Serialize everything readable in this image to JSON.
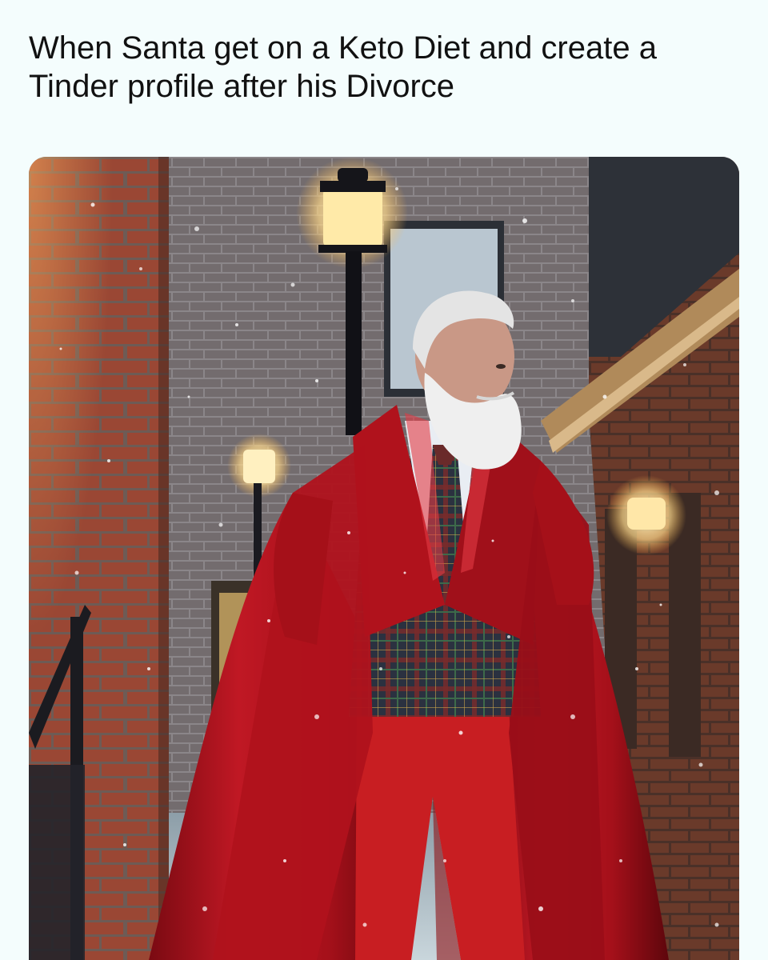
{
  "post": {
    "caption": "When Santa get on a Keto Diet and create a Tinder profile after his Divorce"
  },
  "photo": {
    "subject": "santa-figure",
    "colors": {
      "background": "#f4fdfd",
      "caption_text": "#111111",
      "coat_red": "#b0121c",
      "pants_red": "#c81e22",
      "brick": "#8a3a2a",
      "beard": "#eeeeee",
      "lamp_glow": "#ffe9a8",
      "plaid_dark": "#2a3140"
    }
  }
}
